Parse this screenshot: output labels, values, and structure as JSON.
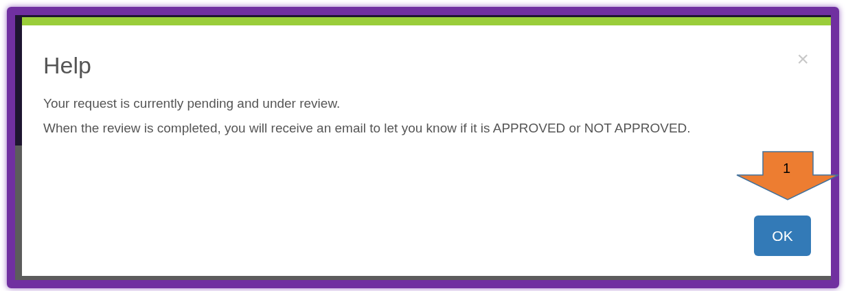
{
  "dialog": {
    "title": "Help",
    "close": "×",
    "lines": [
      "Your request is currently pending and under review.",
      "When the review is completed, you will receive an email to let you know if it is APPROVED or NOT APPROVED."
    ],
    "buttons": [
      {
        "label": "OK",
        "kind": "primary"
      }
    ]
  },
  "annotation": {
    "label": "1"
  }
}
